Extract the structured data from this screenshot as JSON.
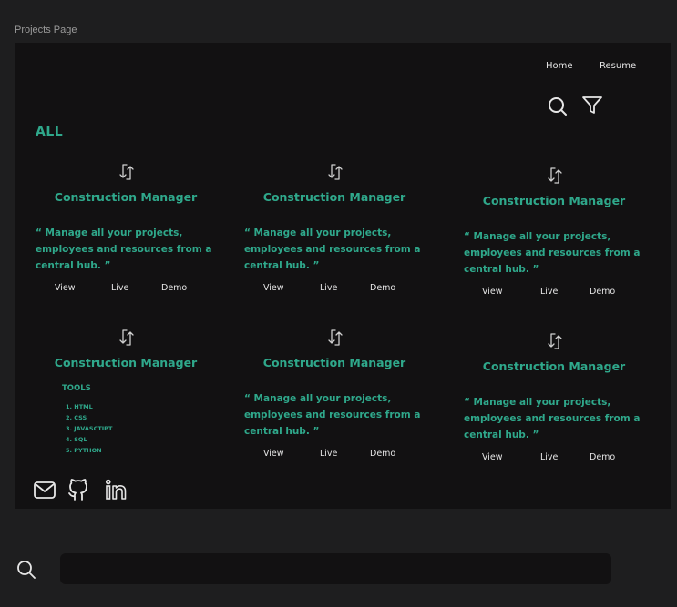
{
  "frame_label": "Projects Page",
  "nav": {
    "home": "Home",
    "resume": "Resume"
  },
  "icons": {
    "search": "search-icon",
    "filter": "filter-icon",
    "card": "refresh-arrows-icon",
    "mail": "mail-icon",
    "github": "github-icon",
    "linkedin": "linkedin-icon"
  },
  "filter_label": "ALL",
  "colors": {
    "accent": "#2fa88b",
    "frame_bg": "#121112",
    "page_bg": "#1e1e1f",
    "text": "#e6e6e6"
  },
  "cards": [
    {
      "title": "Construction Manager",
      "description": "“ Manage all your projects, employees and resources from a central hub. ”",
      "buttons": {
        "view": "View",
        "live": "Live",
        "demo": "Demo"
      }
    },
    {
      "title": "Construction Manager",
      "description": "“ Manage all your projects, employees and resources from a central hub. ”",
      "buttons": {
        "view": "View",
        "live": "Live",
        "demo": "Demo"
      }
    },
    {
      "title": "Construction Manager",
      "description": "“ Manage all your projects, employees and resources from a central hub. ”",
      "buttons": {
        "view": "View",
        "live": "Live",
        "demo": "Demo"
      }
    },
    {
      "title": "Construction Manager",
      "tools_title": "TOOLS",
      "tools": [
        "1. HTML",
        "2. CSS",
        "3. JAVASCTIPT",
        "4. SQL",
        "5. PYTHON"
      ]
    },
    {
      "title": "Construction Manager",
      "description": "“ Manage all your projects, employees and resources from a central hub. ”",
      "buttons": {
        "view": "View",
        "live": "Live",
        "demo": "Demo"
      }
    },
    {
      "title": "Construction Manager",
      "description": "“ Manage all your projects, employees and resources from a central hub. ”",
      "buttons": {
        "view": "View",
        "live": "Live",
        "demo": "Demo"
      }
    }
  ],
  "bottom_search": {
    "value": "",
    "placeholder": ""
  }
}
